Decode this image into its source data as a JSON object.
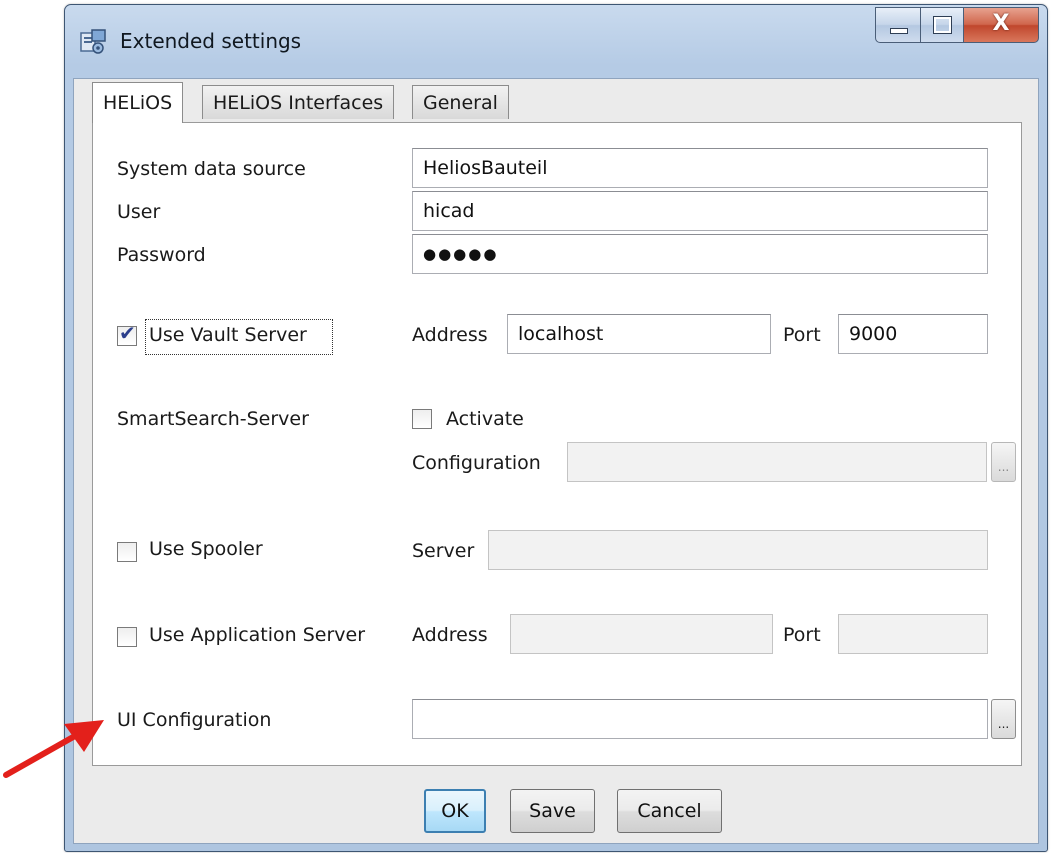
{
  "window": {
    "title": "Extended settings",
    "icon": "app-settings-icon"
  },
  "tabs": [
    {
      "label": "HELiOS",
      "active": true
    },
    {
      "label": "HELiOS Interfaces",
      "active": false
    },
    {
      "label": "General",
      "active": false
    }
  ],
  "helios": {
    "system_data_source": {
      "label": "System data source",
      "value": "HeliosBauteil"
    },
    "user": {
      "label": "User",
      "value": "hicad"
    },
    "password": {
      "label": "Password",
      "value": "●●●●●"
    },
    "vault": {
      "label": "Use Vault Server",
      "checked": true,
      "address_label": "Address",
      "address_value": "localhost",
      "port_label": "Port",
      "port_value": "9000"
    },
    "smartsearch": {
      "label": "SmartSearch-Server",
      "activate_label": "Activate",
      "activate_checked": false,
      "configuration_label": "Configuration",
      "configuration_value": "",
      "browse_label": "..."
    },
    "spooler": {
      "label": "Use Spooler",
      "checked": false,
      "server_label": "Server",
      "server_value": ""
    },
    "app_server": {
      "label": "Use Application Server",
      "checked": false,
      "address_label": "Address",
      "address_value": "",
      "port_label": "Port",
      "port_value": ""
    },
    "ui_config": {
      "label": "UI Configuration",
      "value": "",
      "browse_label": "..."
    }
  },
  "buttons": {
    "ok": "OK",
    "save": "Save",
    "cancel": "Cancel"
  },
  "caption": {
    "close_glyph": "X"
  },
  "colors": {
    "title_bar": "#b5cbe5",
    "close_button": "#c0472d",
    "default_button_border": "#3c7fb1",
    "annotation_arrow": "#e3201b"
  }
}
